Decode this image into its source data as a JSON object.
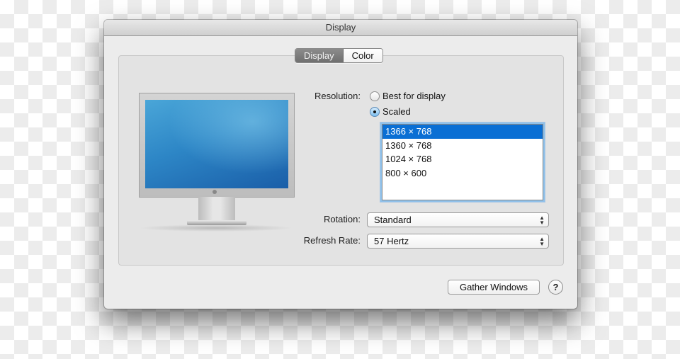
{
  "window": {
    "title": "Display"
  },
  "tabs": [
    {
      "label": "Display",
      "active": true
    },
    {
      "label": "Color",
      "active": false
    }
  ],
  "resolution": {
    "label": "Resolution:",
    "options": [
      {
        "label": "Best for display",
        "checked": false
      },
      {
        "label": "Scaled",
        "checked": true
      }
    ],
    "list": [
      {
        "label": "1366 × 768",
        "selected": true
      },
      {
        "label": "1360 × 768",
        "selected": false
      },
      {
        "label": "1024 × 768",
        "selected": false
      },
      {
        "label": "800 × 600",
        "selected": false
      }
    ]
  },
  "rotation": {
    "label": "Rotation:",
    "value": "Standard"
  },
  "refresh_rate": {
    "label": "Refresh Rate:",
    "value": "57 Hertz"
  },
  "popup_arrows": "▲▼",
  "buttons": {
    "gather_windows": "Gather Windows",
    "help": "?"
  },
  "colors": {
    "selection": "#0a6fd4",
    "focus_ring": "#8fc1ea"
  }
}
